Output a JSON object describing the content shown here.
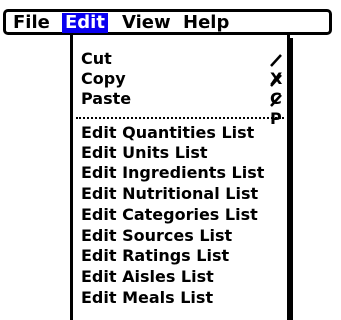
{
  "menubar": {
    "file_label": "File",
    "edit_label": "Edit",
    "view_label": "View",
    "help_label": "Help",
    "selected": "Edit"
  },
  "edit_menu": {
    "items": [
      {
        "label": "Cut",
        "shortcut": "X"
      },
      {
        "label": "Copy",
        "shortcut": "C"
      },
      {
        "label": "Paste",
        "shortcut": "P"
      },
      {
        "label": "Edit Quantities List"
      },
      {
        "label": "Edit Units List"
      },
      {
        "label": "Edit Ingredients List"
      },
      {
        "label": "Edit Nutritional List"
      },
      {
        "label": "Edit Categories List"
      },
      {
        "label": "Edit Sources List"
      },
      {
        "label": "Edit Ratings List"
      },
      {
        "label": "Edit Aisles List"
      },
      {
        "label": "Edit Meals List"
      }
    ]
  },
  "icons": {
    "command_stroke": "command-stroke-icon"
  },
  "colors": {
    "selection": "#0a00f0",
    "background": "#ffffff",
    "text": "#000000"
  }
}
